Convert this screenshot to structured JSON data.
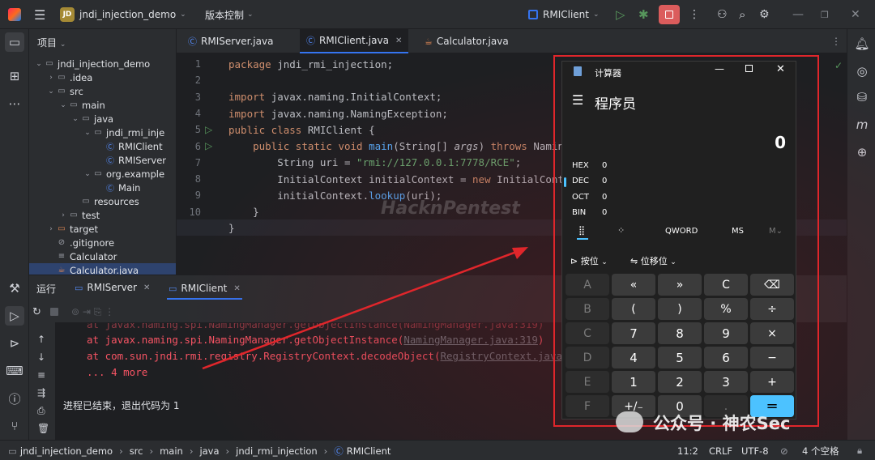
{
  "titlebar": {
    "project_badge": "JD",
    "project_name": "jndi_injection_demo",
    "vcs": "版本控制",
    "run_config": "RMIClient"
  },
  "project_panel": {
    "title": "项目",
    "tree": [
      {
        "label": "jndi_injection_demo",
        "depth": 0,
        "chev": "⌄",
        "icon": "folder"
      },
      {
        "label": ".idea",
        "depth": 1,
        "chev": "›",
        "icon": "folder"
      },
      {
        "label": "src",
        "depth": 1,
        "chev": "⌄",
        "icon": "folder"
      },
      {
        "label": "main",
        "depth": 2,
        "chev": "⌄",
        "icon": "folder"
      },
      {
        "label": "java",
        "depth": 3,
        "chev": "⌄",
        "icon": "folder"
      },
      {
        "label": "jndi_rmi_inje",
        "depth": 4,
        "chev": "⌄",
        "icon": "package"
      },
      {
        "label": "RMIClient",
        "depth": 5,
        "chev": "",
        "icon": "class"
      },
      {
        "label": "RMIServer",
        "depth": 5,
        "chev": "",
        "icon": "class"
      },
      {
        "label": "org.example",
        "depth": 4,
        "chev": "⌄",
        "icon": "package"
      },
      {
        "label": "Main",
        "depth": 5,
        "chev": "",
        "icon": "class"
      },
      {
        "label": "resources",
        "depth": 3,
        "chev": "",
        "icon": "folder"
      },
      {
        "label": "test",
        "depth": 2,
        "chev": "›",
        "icon": "folder"
      },
      {
        "label": "target",
        "depth": 1,
        "chev": "›",
        "icon": "folder-orange"
      },
      {
        "label": ".gitignore",
        "depth": 1,
        "chev": "",
        "icon": "ignore"
      },
      {
        "label": "Calculator",
        "depth": 1,
        "chev": "",
        "icon": "file"
      },
      {
        "label": "Calculator.java",
        "depth": 1,
        "chev": "",
        "icon": "java"
      }
    ]
  },
  "editor": {
    "tabs": [
      {
        "label": "RMIServer.java"
      },
      {
        "label": "RMIClient.java"
      },
      {
        "label": "Calculator.java"
      }
    ],
    "line_numbers": [
      "1",
      "2",
      "3",
      "4",
      "5",
      "6",
      "7",
      "8",
      "9",
      "10",
      "11"
    ]
  },
  "run_panel": {
    "label": "运行",
    "tabs": [
      "RMIServer",
      "RMIClient"
    ],
    "lines": [
      "at javax.naming.spi.NamingManager.getObjectInstance(",
      "NamingManager.java:319",
      ")",
      "at com.sun.jndi.rmi.registry.RegistryContext.decodeObject(",
      "RegistryContext.java:4",
      "... 4 more"
    ],
    "exit_msg": "进程已结束，退出代码为 1"
  },
  "statusbar": {
    "crumbs": [
      "jndi_injection_demo",
      "src",
      "main",
      "java",
      "jndi_rmi_injection",
      "RMIClient"
    ],
    "pos": "11:2",
    "eol": "CRLF",
    "enc": "UTF-8",
    "indent": "4 个空格"
  },
  "calculator": {
    "title": "计算器",
    "mode": "程序员",
    "display": "0",
    "bases": [
      {
        "name": "HEX",
        "value": "0"
      },
      {
        "name": "DEC",
        "value": "0"
      },
      {
        "name": "OCT",
        "value": "0"
      },
      {
        "name": "BIN",
        "value": "0"
      }
    ],
    "word": "QWORD",
    "ms": "MS",
    "mplus": "M⌄",
    "bitwise": "按位",
    "bitshift": "位移位",
    "keys": [
      [
        "A",
        "«",
        "»",
        "C",
        "⌫"
      ],
      [
        "B",
        "(",
        ")",
        "%",
        "÷"
      ],
      [
        "C",
        "7",
        "8",
        "9",
        "×"
      ],
      [
        "D",
        "4",
        "5",
        "6",
        "−"
      ],
      [
        "E",
        "1",
        "2",
        "3",
        "+"
      ],
      [
        "F",
        "+∕₋",
        "0",
        ".",
        "="
      ]
    ]
  },
  "watermark": "公众号 · 神农Sec",
  "bg_text": "HacknPentest"
}
